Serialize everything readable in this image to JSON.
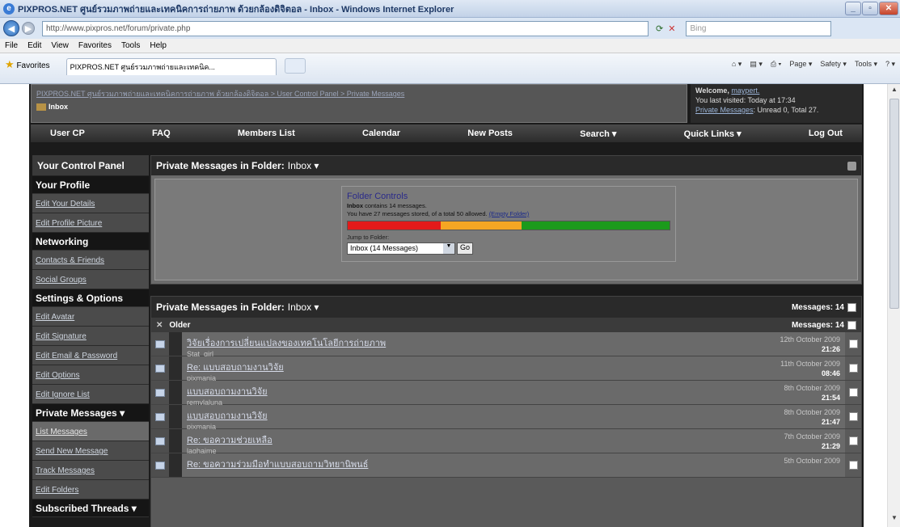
{
  "browser": {
    "title": "PIXPROS.NET ศูนย์รวมภาพถ่ายและเทคนิคการถ่ายภาพ ด้วยกล้องดิจิตอล - Inbox - Windows Internet Explorer",
    "address": "http://www.pixpros.net/forum/private.php",
    "address_domain": "pixpros.net",
    "search_placeholder": "Bing",
    "menu": [
      "File",
      "Edit",
      "View",
      "Favorites",
      "Tools",
      "Help"
    ],
    "favorites_label": "Favorites",
    "tab_title": "PIXPROS.NET ศูนย์รวมภาพถ่ายและเทคนิค...",
    "command_items": [
      "Page ▾",
      "Safety ▾",
      "Tools ▾"
    ]
  },
  "forum": {
    "breadcrumb": "PIXPROS.NET ศูนย์รวมภาพถ่ายและเทคนิคการถ่ายภาพ ด้วยกล้องดิจิตอล > User Control Panel > Private Messages",
    "current_page": "Inbox",
    "welcome": {
      "greeting": "Welcome,",
      "username": "maypert.",
      "last_visited": "You last visited: Today at 17:34",
      "pm_link": "Private Messages",
      "pm_status": ": Unread 0, Total 27."
    },
    "nav": [
      "User CP",
      "FAQ",
      "Members List",
      "Calendar",
      "New Posts",
      "Search ▾",
      "Quick Links ▾",
      "Log Out"
    ]
  },
  "control_panel": {
    "title": "Your Control Panel",
    "sections": [
      {
        "name": "Your Profile",
        "items": [
          "Edit Your Details",
          "Edit Profile Picture"
        ]
      },
      {
        "name": "Networking",
        "items": [
          "Contacts & Friends",
          "Social Groups"
        ]
      },
      {
        "name": "Settings & Options",
        "items": [
          "Edit Avatar",
          "Edit Signature",
          "Edit Email & Password",
          "Edit Options",
          "Edit Ignore List"
        ]
      },
      {
        "name": "Private Messages ▾",
        "items": [
          "List Messages",
          "Send New Message",
          "Track Messages",
          "Edit Folders"
        ]
      },
      {
        "name": "Subscribed Threads ▾",
        "items": []
      }
    ]
  },
  "folder_box": {
    "heading": "Private Messages in Folder:",
    "folder": "Inbox ▾",
    "controls_title": "Folder Controls",
    "inbox_name": "Inbox",
    "inbox_count": "contains 14 messages.",
    "storage_text": "You have 27 messages stored, of a total 50 allowed.",
    "empty_link": "(Empty Folder)",
    "jump_label": "Jump to Folder:",
    "jump_value": "Inbox (14 Messages)",
    "go_label": "Go",
    "usage_fraction": 0.54
  },
  "message_list": {
    "heading": "Private Messages in Folder:",
    "folder": "Inbox ▾",
    "count_label": "Messages: 14",
    "group_name": "Older",
    "group_count": "Messages: 14",
    "messages": [
      {
        "subject": "วิจัยเรื่องการเปลี่ยนแปลงของเทคโนโลยีการถ่ายภาพ",
        "sender": "Stat_girl",
        "date": "12th October 2009",
        "time": "21:26"
      },
      {
        "subject": "Re: แบบสอบถามงานวิจัย",
        "sender": "pixmania",
        "date": "11th October 2009",
        "time": "08:46"
      },
      {
        "subject": "แบบสอบถามงานวิจัย",
        "sender": "remylaluna",
        "date": "8th October 2009",
        "time": "21:54"
      },
      {
        "subject": "แบบสอบถามงานวิจัย",
        "sender": "pixmania",
        "date": "8th October 2009",
        "time": "21:47"
      },
      {
        "subject": "Re: ขอความช่วยเหลือ",
        "sender": "laghaime",
        "date": "7th October 2009",
        "time": "21:29"
      },
      {
        "subject": "Re: ขอความร่วมมือทำแบบสอบถามวิทยานิพนธ์",
        "sender": "",
        "date": "5th October 2009",
        "time": ""
      }
    ]
  },
  "colors": {
    "bar_red": "#e31a1a",
    "bar_orange": "#f5a623",
    "bar_green": "#1c9a1c"
  }
}
